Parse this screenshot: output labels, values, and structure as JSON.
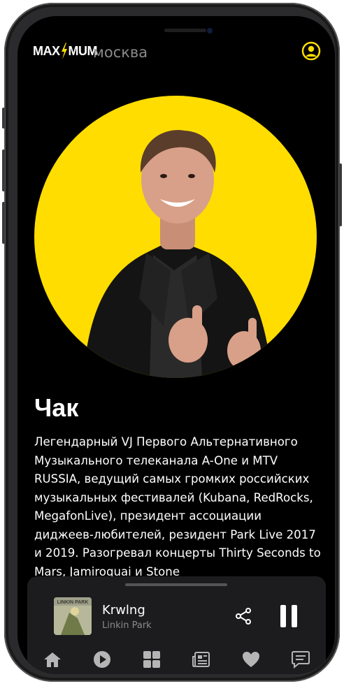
{
  "header": {
    "logo_text_left": "MAX",
    "logo_text_right": "MUM",
    "city": "москва",
    "profile_icon": "user-circle-icon"
  },
  "colors": {
    "accent": "#ffdd00",
    "background": "#000000",
    "player_bg": "#1c1c1e",
    "muted_text": "#8a8a8a"
  },
  "host": {
    "name": "Чак",
    "bio": "Легендарный VJ Первого Альтернативного Музыкального телеканала A-One и MTV RUSSIA, ведущий самых громких российских музыкальных фестивалей (Kubana, RedRocks, MegafonLive), президент ассоциации диджеев-любителей, резидент Park Live 2017 и 2019. Разогревал концерты Thirty Seconds to Mars, Jamiroquai и Stone"
  },
  "player": {
    "track": "Krwlng",
    "artist": "Linkin Park",
    "cover_label": "LINKIN PARK",
    "share_icon": "share-icon",
    "pause_icon": "pause-icon"
  },
  "tabbar": {
    "items": [
      {
        "icon": "home-icon"
      },
      {
        "icon": "play-circle-icon"
      },
      {
        "icon": "grid-icon"
      },
      {
        "icon": "news-icon"
      },
      {
        "icon": "heart-icon"
      },
      {
        "icon": "chat-icon"
      }
    ]
  }
}
